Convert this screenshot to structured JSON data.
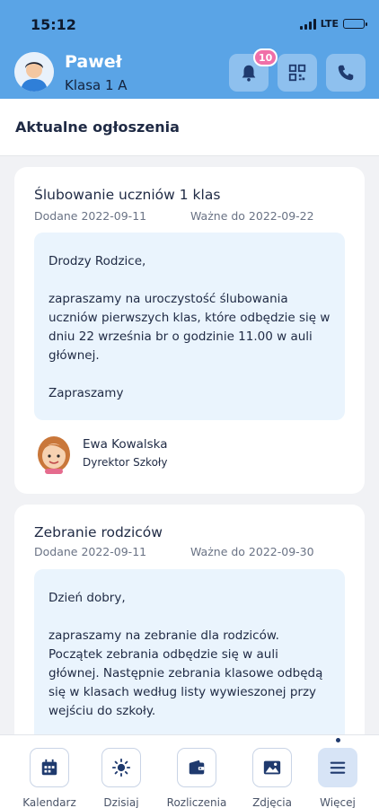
{
  "status_bar": {
    "time": "15:12",
    "network": "LTE",
    "battery_level": 0.2
  },
  "header": {
    "user_name": "Paweł",
    "user_class": "Klasa 1 A",
    "notifications_count": "10",
    "accent_color": "#5aa4e6",
    "buttons": [
      "bell-icon",
      "qr-code-icon",
      "phone-icon"
    ]
  },
  "section": {
    "title": "Aktualne ogłoszenia"
  },
  "announcements": [
    {
      "title": "Ślubowanie uczniów 1 klas",
      "added": "Dodane 2022-09-11",
      "valid": "Ważne do 2022-09-22",
      "paragraphs": [
        "Drodzy Rodzice,",
        "zapraszamy na uroczystość ślubowania uczniów pierwszych klas, które odbędzie się w dniu 22 września br o godzinie 11.00 w auli głównej.",
        "Zapraszamy"
      ],
      "author": {
        "name": "Ewa Kowalska",
        "role": "Dyrektor Szkoły"
      }
    },
    {
      "title": "Zebranie rodziców",
      "added": "Dodane 2022-09-11",
      "valid": "Ważne do 2022-09-30",
      "paragraphs": [
        "Dzień dobry,",
        "zapraszamy na zebranie dla rodziców. Początek zebrania odbędzie się w auli głównej. Następnie zebrania klasowe odbędą się w klasach według listy wywieszonej przy wejściu do szkoły."
      ]
    }
  ],
  "tabbar": {
    "tabs": [
      {
        "label": "Kalendarz",
        "icon": "calendar-icon"
      },
      {
        "label": "Dzisiaj",
        "icon": "sun-icon"
      },
      {
        "label": "Rozliczenia",
        "icon": "wallet-icon"
      },
      {
        "label": "Zdjęcia",
        "icon": "photo-icon"
      },
      {
        "label": "Więcej",
        "icon": "menu-icon"
      }
    ],
    "active": "Więcej"
  }
}
